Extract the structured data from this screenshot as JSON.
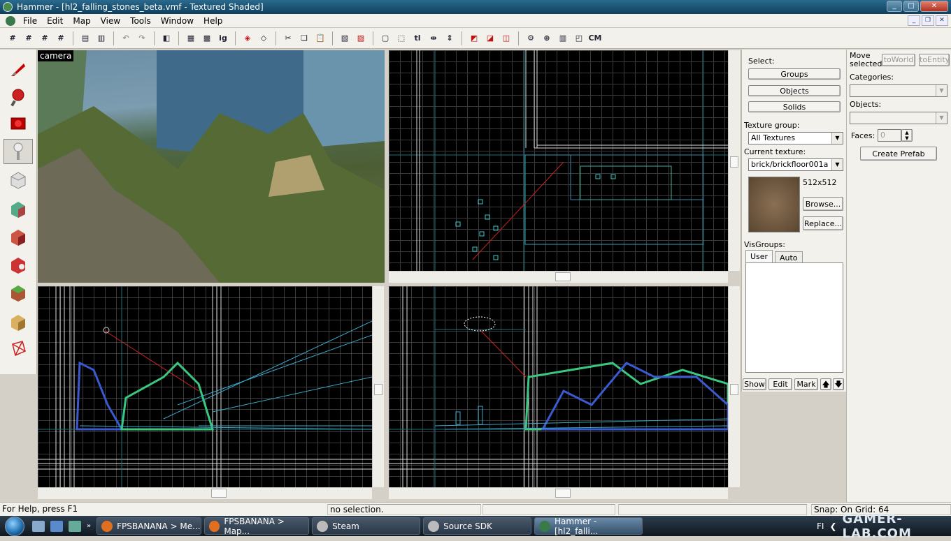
{
  "window": {
    "title": "Hammer - [hl2_falling_stones_beta.vmf - Textured Shaded]",
    "controls": [
      "_",
      "□",
      "✕"
    ]
  },
  "menu": [
    "File",
    "Edit",
    "Map",
    "View",
    "Tools",
    "Window",
    "Help"
  ],
  "toolbar": {
    "cm_label": "CM",
    "ig_label": "ig",
    "tl_label": "tl"
  },
  "viewports": {
    "camera_label": "camera"
  },
  "select_panel": {
    "select_label": "Select:",
    "groups": "Groups",
    "objects": "Objects",
    "solids": "Solids",
    "texture_group_label": "Texture group:",
    "texture_group_value": "All Textures",
    "current_texture_label": "Current texture:",
    "current_texture_value": "brick/brickfloor001a",
    "texture_size": "512x512",
    "browse": "Browse...",
    "replace": "Replace...",
    "visgroups_label": "VisGroups:",
    "tab_user": "User",
    "tab_auto": "Auto",
    "show": "Show",
    "edit": "Edit",
    "mark": "Mark",
    "up": "🡅",
    "down": "🡇"
  },
  "entity_panel": {
    "move_selected_label": "Move\nselected:",
    "to_world": "toWorld",
    "to_entity": "toEntity",
    "categories_label": "Categories:",
    "objects_label": "Objects:",
    "faces_label": "Faces:",
    "faces_value": "0",
    "create_prefab": "Create Prefab"
  },
  "status": {
    "help": "For Help, press F1",
    "selection": "no selection.",
    "snap": "Snap: On Grid: 64"
  },
  "taskbar": {
    "tasks": [
      "FPSBANANA > Me...",
      "FPSBANANA > Map...",
      "Steam",
      "Source SDK",
      "Hammer - [hl2_falli..."
    ],
    "lang": "FI",
    "watermark": "GAMER-LAB.COM"
  }
}
